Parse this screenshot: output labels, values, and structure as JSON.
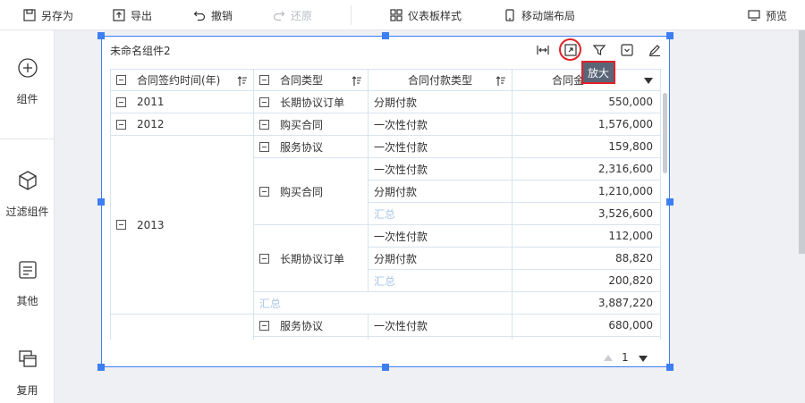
{
  "toolbar": {
    "save_as": "另存为",
    "export": "导出",
    "undo": "撤销",
    "redo": "还原",
    "dashboard_style": "仪表板样式",
    "mobile_layout": "移动端布局",
    "preview": "预览"
  },
  "sidebar": {
    "items": [
      {
        "label": "组件",
        "icon": "plus-circle-icon"
      },
      {
        "label": "过滤组件",
        "icon": "cube-icon"
      },
      {
        "label": "其他",
        "icon": "text-box-icon"
      },
      {
        "label": "复用",
        "icon": "stacked-windows-icon"
      }
    ]
  },
  "widget": {
    "title": "未命名组件2",
    "tooltip": "放大"
  },
  "table": {
    "headers": [
      "合同签约时间(年)",
      "合同类型",
      "合同付款类型",
      "合同金额(求和)"
    ],
    "header_visible": [
      "合同签约时间(年)",
      "合同类型",
      "合同付款类型",
      "合同金"
    ],
    "header_tail": "额(求和)",
    "years": [
      "2011",
      "2012",
      "2013"
    ],
    "rows": [
      {
        "year": "2011",
        "type": "长期协议订单",
        "pay": "分期付款",
        "amount": "550,000"
      },
      {
        "year": "2012",
        "type": "购买合同",
        "pay": "一次性付款",
        "amount": "1,576,000"
      },
      {
        "year": "2013",
        "type": "服务协议",
        "pay": "一次性付款",
        "amount": "159,800"
      },
      {
        "year": "2013",
        "type": "购买合同",
        "pay": "一次性付款",
        "amount": "2,316,600"
      },
      {
        "year": "2013",
        "type": "购买合同",
        "pay": "分期付款",
        "amount": "1,210,000"
      },
      {
        "year": "2013",
        "type": "购买合同",
        "pay": "汇总",
        "amount": "3,526,600"
      },
      {
        "year": "2013",
        "type": "长期协议订单",
        "pay": "一次性付款",
        "amount": "112,000"
      },
      {
        "year": "2013",
        "type": "长期协议订单",
        "pay": "分期付款",
        "amount": "88,820"
      },
      {
        "year": "2013",
        "type": "长期协议订单",
        "pay": "汇总",
        "amount": "200,820"
      },
      {
        "year": "2013",
        "type": "汇总",
        "pay": "",
        "amount": "3,887,220"
      },
      {
        "year": "",
        "type": "服务协议",
        "pay": "一次性付款",
        "amount": "680,000"
      }
    ]
  },
  "pager": {
    "page": "1"
  },
  "colors": {
    "accent": "#3d7ef3",
    "highlight": "#e0212a",
    "subtotal_text": "#a8c6e8"
  }
}
